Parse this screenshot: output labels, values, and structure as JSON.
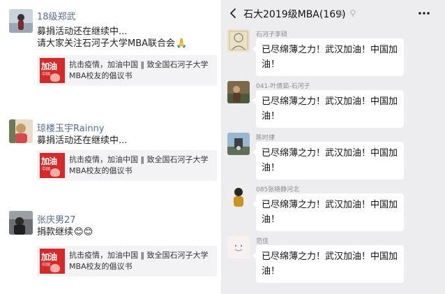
{
  "moments": {
    "posts": [
      {
        "name": "18级郑武",
        "lines": [
          "募捐活动还在继续中...",
          "请大家关注石河子大学MBA联合会"
        ],
        "emoji": "🙏",
        "share": {
          "thumb_text": "加油",
          "thumb_sub": "中国",
          "text": "抗击疫情，加油中国 ‖ 致全国石河子大学MBA校友的倡议书"
        }
      },
      {
        "name": "琼楼玉宇Rainny",
        "lines": [
          "募捐活动还在继续中..."
        ],
        "share": {
          "thumb_text": "加油",
          "thumb_sub": "中国",
          "text": "抗击疫情，加油中国 ‖ 致全国石河子大学MBA校友的倡议书"
        }
      },
      {
        "name": "张庆男27",
        "lines": [
          "捐款继续"
        ],
        "emoji": "😊😊",
        "share": {
          "thumb_text": "加油",
          "thumb_sub": "中国",
          "text": "抗击疫情，加油中国 ‖ 致全国石河子大学MBA校友的倡议书"
        }
      }
    ]
  },
  "chat": {
    "title": "石大2019级MBA(169)",
    "icons": {
      "back": "chevron-left-icon",
      "mute": "mute-icon",
      "pin": "pin-icon",
      "more": "more-icon"
    },
    "messages": [
      {
        "sender": "石河子李硕",
        "text": "已尽绵薄之力！武汉加油！中国加油！"
      },
      {
        "sender": "041-叶倩茹-石河子",
        "text": "已尽绵薄之力！武汉加油！中国加油！"
      },
      {
        "sender": "陈时律",
        "text": "已尽绵薄之力！武汉加油！中国加油！"
      },
      {
        "sender": "085张晓静河北",
        "text": "已尽绵薄之力！武汉加油！中国加油！"
      },
      {
        "sender": "范佳",
        "text": "已尽绵薄之力！武汉加油！中国加油！"
      }
    ]
  }
}
